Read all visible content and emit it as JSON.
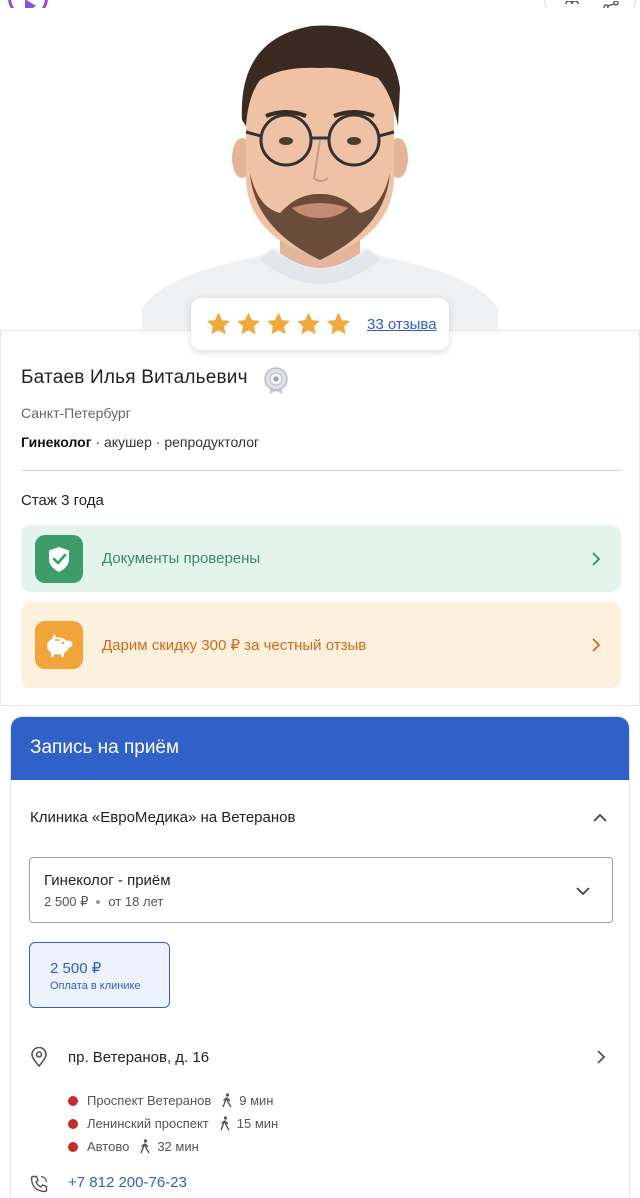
{
  "rating": {
    "stars": 5,
    "reviews_label": "33 отзыва"
  },
  "doctor": {
    "name": "Батаев Илья Витальевич",
    "city": "Санкт-Петербург",
    "specialty_main": "Гинеколог",
    "specialty_rest": " · акушер · репродуктолог",
    "experience": "Стаж 3 года"
  },
  "banners": {
    "documents": "Документы проверены",
    "promo": "Дарим скидку 300 ₽ за честный отзыв"
  },
  "booking": {
    "title": "Запись на приём",
    "clinic": "Клиника «ЕвроМедика» на Ветеранов",
    "service": {
      "name": "Гинеколог - приём",
      "price": "2 500 ₽",
      "age": "от 18 лет"
    },
    "price_chip": {
      "amount": "2 500 ₽",
      "note": "Оплата в клинике"
    },
    "address": "пр. Ветеранов, д. 16",
    "metro": [
      {
        "station": "Проспект Ветеранов",
        "walk": "9 мин"
      },
      {
        "station": "Ленинский проспект",
        "walk": "15 мин"
      },
      {
        "station": "Автово",
        "walk": "32 мин"
      }
    ],
    "phone": "+7 812 200-76-23"
  },
  "colors": {
    "accent_blue": "#2f61c9",
    "star": "#f2a93b",
    "docs_bg": "#e3f4ec",
    "docs_icon": "#3e9c6a",
    "promo_bg": "#fdf1de",
    "promo_icon": "#f0a43a",
    "metro_red": "#c62b2b",
    "play_purple": "#8e4fd8"
  },
  "icons": [
    "play-icon",
    "heart-icon",
    "share-icon",
    "star-icon",
    "award-icon",
    "shield-check-icon",
    "piggy-bank-icon",
    "chevron-right-icon",
    "chevron-up-icon",
    "chevron-down-icon",
    "map-pin-icon",
    "walk-icon",
    "phone-icon"
  ]
}
